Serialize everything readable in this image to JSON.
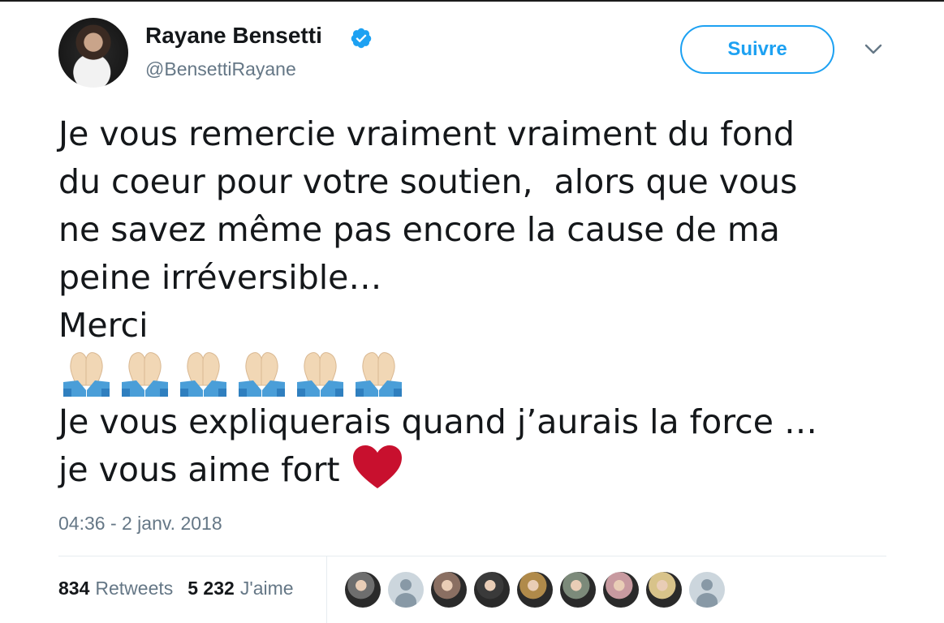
{
  "author": {
    "name": "Rayane Bensetti",
    "handle": "@BensettiRayane",
    "verified": true,
    "avatar_icon": "profile-photo"
  },
  "actions": {
    "follow_label": "Suivre",
    "menu_icon": "chevron-down-icon"
  },
  "tweet": {
    "lines": [
      "Je vous remercie vraiment vraiment du fond",
      "du coeur pour votre soutien,  alors que vous",
      "ne savez même pas encore la cause de ma",
      "peine irréversible…",
      "Merci"
    ],
    "emoji_count": 6,
    "emoji_icon": "folded-hands-icon",
    "closing_lines": [
      "Je vous expliquerais quand j’aurais la force …",
      "je vous aime fort"
    ],
    "heart_icon": "red-heart-icon",
    "timestamp": "04:36 - 2 janv. 2018"
  },
  "stats": {
    "retweets_count": "834",
    "retweets_label": "Retweets",
    "likes_count": "5 232",
    "likes_label": "J'aime"
  },
  "likers": [
    {
      "kind": "photo",
      "color": "#6e6e6e"
    },
    {
      "kind": "default"
    },
    {
      "kind": "photo",
      "color": "#8a6f62"
    },
    {
      "kind": "photo",
      "color": "#3a3a3a"
    },
    {
      "kind": "photo",
      "color": "#b08a4a"
    },
    {
      "kind": "photo",
      "color": "#7c8a7a"
    },
    {
      "kind": "photo",
      "color": "#c89aa0"
    },
    {
      "kind": "photo",
      "color": "#d8c38a"
    },
    {
      "kind": "default"
    }
  ],
  "colors": {
    "accent": "#1da1f2",
    "muted": "#657786",
    "text": "#14171a",
    "heart": "#c8102e"
  }
}
